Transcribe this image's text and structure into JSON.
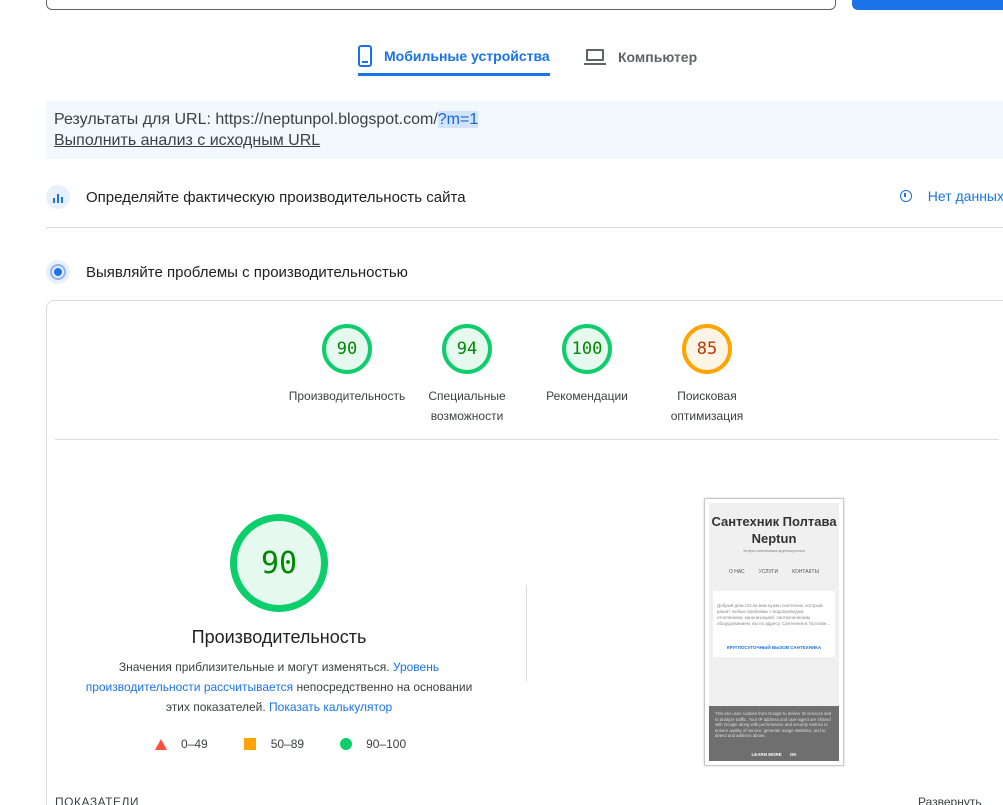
{
  "tabs": [
    {
      "label": "Мобильные устройства",
      "icon": "phone-icon",
      "active": true
    },
    {
      "label": "Компьютер",
      "icon": "laptop-icon",
      "active": false
    }
  ],
  "url_panel": {
    "prefix": "Результаты для URL: https://neptunpol.blogspot.com/",
    "highlight": "?m=1",
    "rerun_link": "Выполнить анализ с исходным URL"
  },
  "field_data": {
    "title": "Определяйте фактическую производительность сайта",
    "status": "Нет данных"
  },
  "lab_data": {
    "title": "Выявляйте проблемы с производительностью"
  },
  "scores": [
    {
      "value": "90",
      "label": "Производительность",
      "rating": "green"
    },
    {
      "value": "94",
      "label": "Специальные возможности",
      "rating": "green"
    },
    {
      "value": "100",
      "label": "Рекомендации",
      "rating": "green"
    },
    {
      "value": "85",
      "label": "Поисковая оптимизация",
      "rating": "orange"
    }
  ],
  "performance": {
    "score": "90",
    "title": "Производительность",
    "desc_1": "Значения приблизительные и могут изменяться. ",
    "desc_link_1": "Уровень производительности рассчитывается",
    "desc_2": " непосредственно на основании этих показателей. ",
    "desc_link_2": "Показать калькулятор"
  },
  "legend": {
    "bad": "0–49",
    "average": "50–89",
    "good": "90–100"
  },
  "preview": {
    "site_title": "Сантехник Полтава Neptun",
    "subtitle": "Услуги сантехника круглосуточно",
    "nav": [
      "О НАС",
      "УСЛУГИ",
      "КОНТАКТЫ"
    ],
    "body": "Добрый день! Если вам нужен сантехник, который решит любые проблемы с водопроводом, отоплением, канализацией, сантехническим оборудованием, вы по адресу. Сантехник в Полтаве...",
    "cta": "КРУГЛОСУТОЧНЫЙ ВЫЗОВ САНТЕХНИКА",
    "cookie_text": "This site uses cookies from Google to deliver its services and to analyze traffic. Your IP address and user-agent are shared with Google along with performance and security metrics to ensure quality of service, generate usage statistics, and to detect and address abuse.",
    "cookie_learn": "LEARN MORE",
    "cookie_ok": "OK"
  },
  "metrics_label": "ПОКАЗАТЕЛИ",
  "expand_label": "Развернуть",
  "colors": {
    "accent": "#1a73e8",
    "good": "#0cce6b",
    "average": "#ffa400",
    "bad": "#ff4e42"
  }
}
